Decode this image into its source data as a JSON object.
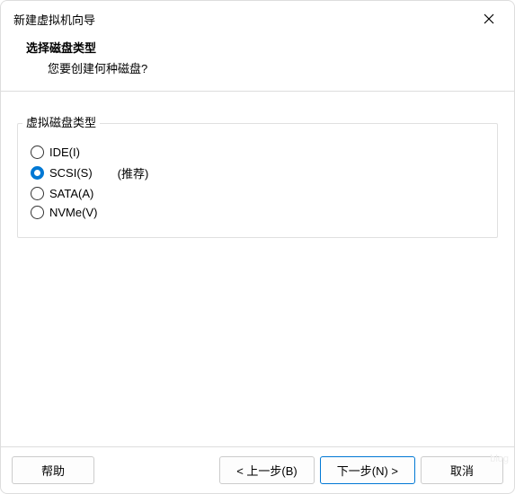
{
  "window": {
    "title": "新建虚拟机向导"
  },
  "header": {
    "title": "选择磁盘类型",
    "subtitle": "您要创建何种磁盘?"
  },
  "fieldset": {
    "label": "虚拟磁盘类型"
  },
  "options": {
    "ide": {
      "label": "IDE(I)"
    },
    "scsi": {
      "label": "SCSI(S)",
      "note": "(推荐)"
    },
    "sata": {
      "label": "SATA(A)"
    },
    "nvme": {
      "label": "NVMe(V)"
    }
  },
  "buttons": {
    "help": "帮助",
    "back": "< 上一步(B)",
    "next": "下一步(N) >",
    "cancel": "取消"
  },
  "watermark": "blog"
}
